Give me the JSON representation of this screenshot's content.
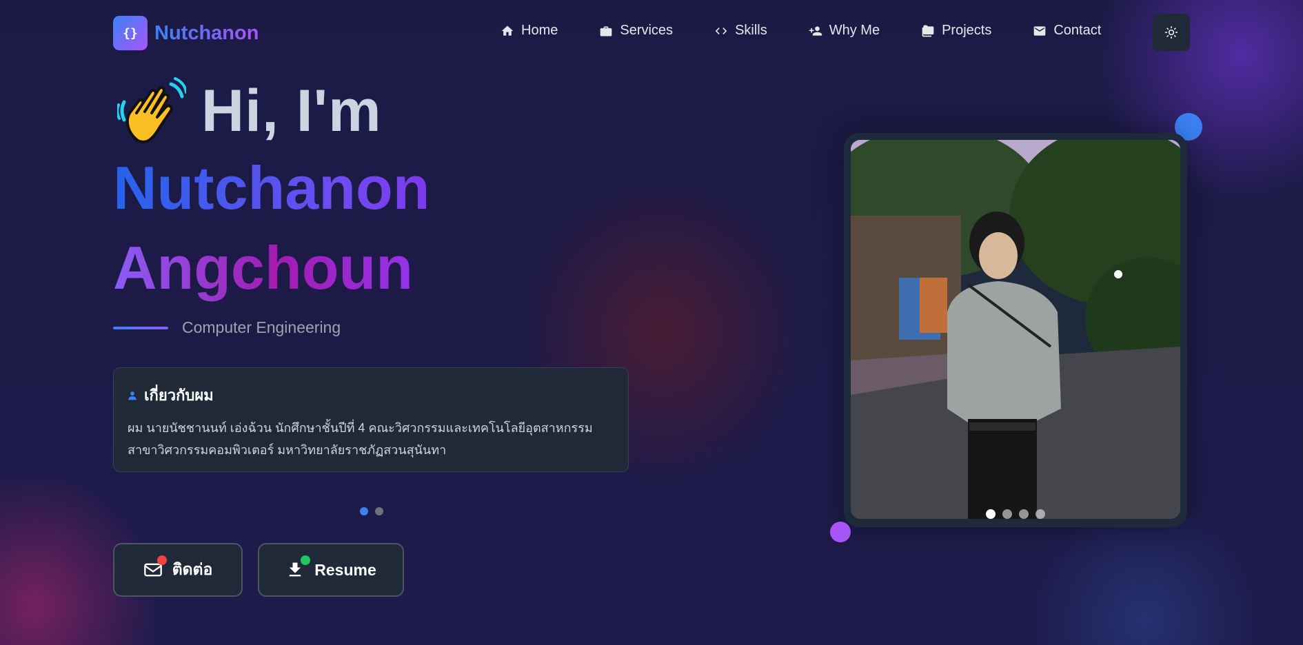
{
  "brand": {
    "icon_text": "{}",
    "name": "Nutchanon"
  },
  "nav": {
    "items": [
      {
        "label": "Home",
        "icon": "home-icon"
      },
      {
        "label": "Services",
        "icon": "briefcase-icon"
      },
      {
        "label": "Skills",
        "icon": "code-icon"
      },
      {
        "label": "Why Me",
        "icon": "person-add-icon"
      },
      {
        "label": "Projects",
        "icon": "folder-icon"
      },
      {
        "label": "Contact",
        "icon": "mail-icon"
      }
    ],
    "theme_toggle_icon": "sun-icon"
  },
  "hero": {
    "greeting": "Hi, I'm",
    "greeting_icon": "waving-hand-icon",
    "first_name": "Nutchanon",
    "last_name": "Angchoun",
    "role": "Computer Engineering"
  },
  "about": {
    "heading": "เกี่ยวกับผม",
    "heading_icon": "person-icon",
    "body_line1": "ผม นายนัชชานนท์ เอ่งฉ้วน นักศึกษาชั้นปีที่ 4 คณะวิศวกรรมและเทคโนโลยีอุตสาหกรรม",
    "body_line2": "สาขาวิศวกรรมคอมพิวเตอร์ มหาวิทยาลัยราชภัฏสวนสุนันทา",
    "slides_total": 2,
    "slide_active": 1
  },
  "cta": {
    "contact_label": "ติดต่อ",
    "contact_icon": "mail-icon",
    "resume_label": "Resume",
    "resume_icon": "download-icon"
  },
  "photo": {
    "slides_total": 4,
    "slide_active": 1
  },
  "colors": {
    "background": "#1e1b4b",
    "accent_blue": "#3b82f6",
    "accent_purple": "#a855f7",
    "card": "#1f2937"
  }
}
